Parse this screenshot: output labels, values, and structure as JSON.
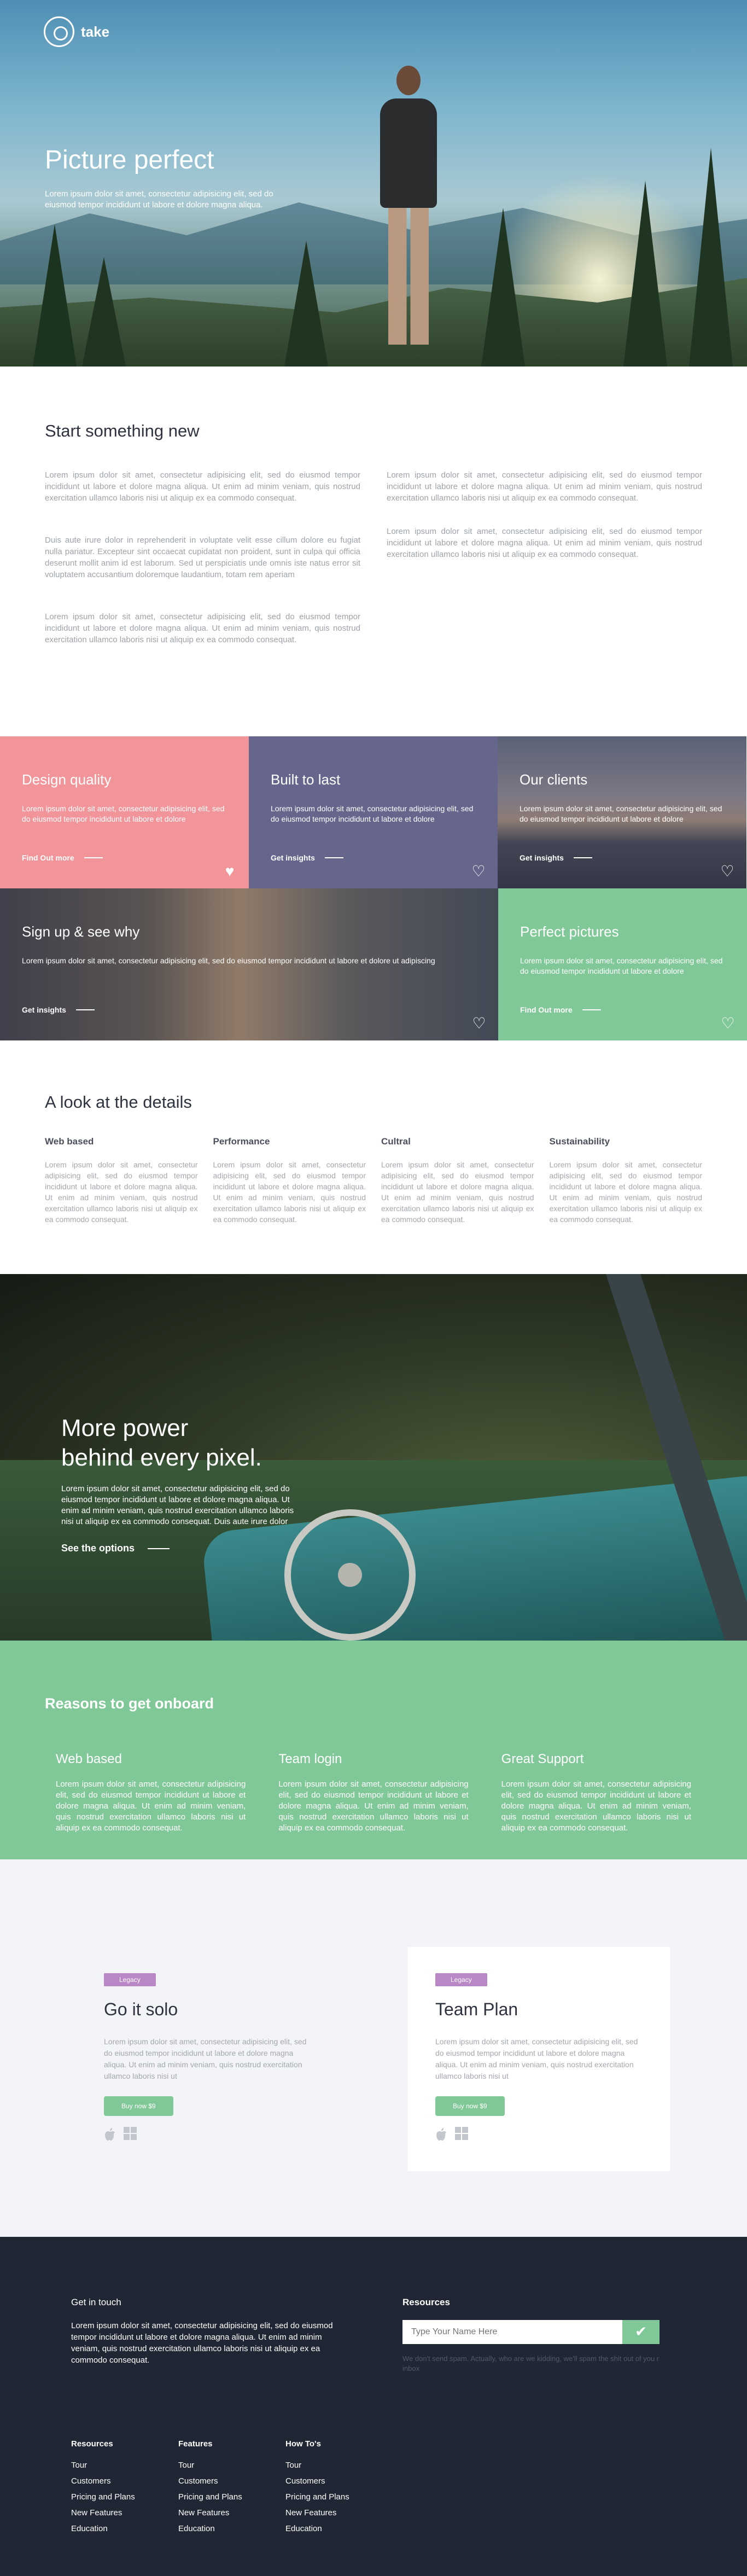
{
  "header": {
    "brand": "take"
  },
  "hero": {
    "title": "Picture perfect",
    "text": "Lorem ipsum dolor sit amet, consectetur adipisicing elit, sed do eiusmod tempor incididunt ut labore et dolore magna aliqua."
  },
  "start": {
    "title": "Start something new",
    "left": [
      "Lorem ipsum dolor sit amet, consectetur adipisicing elit, sed do eiusmod tempor incididunt ut labore et dolore magna aliqua. Ut enim ad minim veniam, quis nostrud exercitation ullamco laboris nisi ut aliquip ex ea commodo consequat.",
      "Duis aute irure dolor in reprehenderit in voluptate velit esse cillum dolore eu fugiat nulla pariatur. Excepteur sint occaecat cupidatat non proident, sunt in culpa qui officia deserunt mollit anim id est laborum. Sed ut perspiciatis unde omnis iste natus error sit voluptatem accusantium doloremque laudantium, totam rem aperiam",
      "Lorem ipsum dolor sit amet, consectetur adipisicing elit, sed do eiusmod tempor incididunt ut labore et dolore magna aliqua. Ut enim ad minim veniam, quis nostrud exercitation ullamco laboris nisi ut aliquip ex ea commodo consequat."
    ],
    "right": [
      "Lorem ipsum dolor sit amet, consectetur adipisicing elit, sed do eiusmod tempor incididunt ut labore et dolore magna aliqua. Ut enim ad minim veniam, quis nostrud exercitation ullamco laboris nisi ut aliquip ex ea commodo consequat.",
      "Lorem ipsum dolor sit amet, consectetur adipisicing elit, sed do eiusmod tempor incididunt ut labore et dolore magna aliqua. Ut enim ad minim veniam, quis nostrud exercitation ullamco laboris nisi ut aliquip ex ea commodo consequat."
    ]
  },
  "tiles": [
    {
      "title": "Design quality",
      "text": "Lorem ipsum dolor sit amet, consectetur adipisicing elit, sed do eiusmod tempor incididunt ut labore et dolore",
      "link": "Find Out more"
    },
    {
      "title": "Built to last",
      "text": "Lorem ipsum dolor sit amet, consectetur adipisicing elit, sed do eiusmod tempor incididunt ut labore et dolore",
      "link": "Get insights"
    },
    {
      "title": "Our clients",
      "text": "Lorem ipsum dolor sit amet, consectetur adipisicing elit, sed do eiusmod tempor incididunt ut labore et dolore",
      "link": "Get insights"
    },
    {
      "title": "Sign up & see why",
      "text": "Lorem ipsum dolor sit amet, consectetur adipisicing elit, sed do eiusmod tempor incididunt ut labore et dolore ut adipiscing",
      "link": "Get insights"
    },
    {
      "title": "Perfect pictures",
      "text": "Lorem ipsum dolor sit amet, consectetur adipisicing elit, sed do eiusmod tempor incididunt ut labore et dolore",
      "link": "Find Out more"
    }
  ],
  "details": {
    "title": "A look at the details",
    "items": [
      {
        "title": "Web based",
        "text": "Lorem ipsum dolor sit amet, consectetur adipisicing elit, sed do eiusmod tempor incididunt ut labore et dolore magna aliqua. Ut enim ad minim veniam, quis nostrud exercitation ullamco laboris nisi ut aliquip ex ea commodo consequat."
      },
      {
        "title": "Performance",
        "text": "Lorem ipsum dolor sit amet, consectetur adipisicing elit, sed do eiusmod tempor incididunt ut labore et dolore magna aliqua. Ut enim ad minim veniam, quis nostrud exercitation ullamco laboris nisi ut aliquip ex ea commodo consequat."
      },
      {
        "title": "Cultral",
        "text": "Lorem ipsum dolor sit amet, consectetur adipisicing elit, sed do eiusmod tempor incididunt ut labore et dolore magna aliqua. Ut enim ad minim veniam, quis nostrud exercitation ullamco laboris nisi ut aliquip ex ea commodo consequat."
      },
      {
        "title": "Sustainability",
        "text": "Lorem ipsum dolor sit amet, consectetur adipisicing elit, sed do eiusmod tempor incididunt ut labore et dolore magna aliqua. Ut enim ad minim veniam, quis nostrud exercitation ullamco laboris nisi ut aliquip ex ea commodo consequat."
      }
    ]
  },
  "power": {
    "title_line1": "More power",
    "title_line2": "behind every pixel.",
    "text": "Lorem ipsum dolor sit amet, consectetur adipisicing elit, sed do eiusmod tempor incididunt ut labore et dolore magna aliqua. Ut enim ad minim veniam, quis nostrud exercitation ullamco laboris nisi ut aliquip ex ea commodo consequat. Duis aute irure dolor",
    "cta": "See the options"
  },
  "reasons": {
    "title": "Reasons to get onboard",
    "items": [
      {
        "title": "Web based",
        "text": "Lorem ipsum dolor sit amet, consectetur adipisicing elit, sed do eiusmod tempor incididunt ut labore et dolore magna aliqua. Ut enim ad minim veniam, quis nostrud exercitation ullamco laboris nisi ut aliquip ex ea commodo consequat."
      },
      {
        "title": "Team login",
        "text": "Lorem ipsum dolor sit amet, consectetur adipisicing elit, sed do eiusmod tempor incididunt ut labore et dolore magna aliqua. Ut enim ad minim veniam, quis nostrud exercitation ullamco laboris nisi ut aliquip ex ea commodo consequat."
      },
      {
        "title": "Great Support",
        "text": "Lorem ipsum dolor sit amet, consectetur adipisicing elit, sed do eiusmod tempor incididunt ut labore et dolore magna aliqua. Ut enim ad minim veniam, quis nostrud exercitation ullamco laboris nisi ut aliquip ex ea commodo consequat."
      }
    ]
  },
  "plans": [
    {
      "badge": "Legacy",
      "title": "Go it solo",
      "text": "Lorem ipsum dolor sit amet, consectetur adipisicing elit, sed do eiusmod tempor incididunt ut labore et dolore magna aliqua. Ut enim ad minim veniam, quis nostrud exercitation ullamco laboris nisi ut",
      "button": "Buy now $9"
    },
    {
      "badge": "Legacy",
      "title": "Team Plan",
      "text": "Lorem ipsum dolor sit amet, consectetur adipisicing elit, sed do eiusmod tempor incididunt ut labore et dolore magna aliqua. Ut enim ad minim veniam, quis nostrud exercitation ullamco laboris nisi ut",
      "button": "Buy now $9"
    }
  ],
  "footer": {
    "touch_title": "Get in touch",
    "touch_text": "Lorem ipsum dolor sit amet, consectetur adipisicing elit, sed do eiusmod tempor incididunt ut labore et dolore magna aliqua. Ut enim ad minim veniam, quis nostrud exercitation ullamco laboris nisi ut aliquip ex ea commodo consequat.",
    "resources_title": "Resources",
    "input_placeholder": "Type Your Name Here",
    "note": "We don't send spam. Actually, who are we kidding, we'll spam the shit out of you r inbox",
    "columns": [
      {
        "title": "Resources",
        "links": [
          "Tour",
          "Customers",
          "Pricing and Plans",
          "New Features",
          "Education"
        ]
      },
      {
        "title": "Features",
        "links": [
          "Tour",
          "Customers",
          "Pricing and Plans",
          "New Features",
          "Education"
        ]
      },
      {
        "title": "How To's",
        "links": [
          "Tour",
          "Customers",
          "Pricing and Plans",
          "New Features",
          "Education"
        ]
      }
    ]
  },
  "colors": {
    "green": "#81c898",
    "pink": "#f1959a",
    "purple": "#66668c",
    "badge": "#b987c6",
    "footer": "#202634"
  },
  "icons": {
    "heart": "heart-icon",
    "check": "check-icon",
    "apple": "apple-icon",
    "windows": "windows-icon"
  }
}
